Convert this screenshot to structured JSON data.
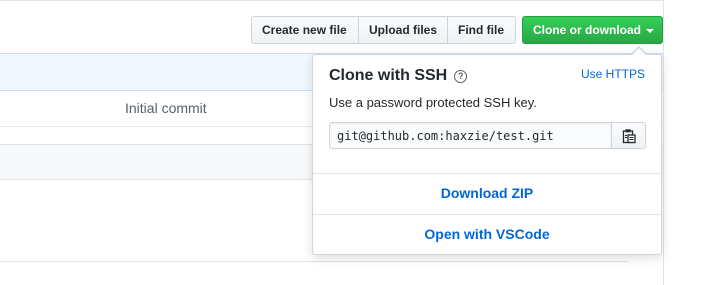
{
  "background": {
    "commit_message": "Initial commit"
  },
  "toolbar": {
    "create_new_file": "Create new file",
    "upload_files": "Upload files",
    "find_file": "Find file",
    "clone_or_download": "Clone or download"
  },
  "clone_panel": {
    "title": "Clone with SSH",
    "help_icon": "question-icon",
    "help_glyph": "?",
    "switch_protocol": "Use HTTPS",
    "description": "Use a password protected SSH key.",
    "url_value": "git@github.com:haxzie/test.git",
    "copy_icon": "clipboard-icon",
    "download_zip": "Download ZIP",
    "open_vscode": "Open with VSCode"
  },
  "colors": {
    "accent_green": "#28a745",
    "link_blue": "#0366d6"
  }
}
